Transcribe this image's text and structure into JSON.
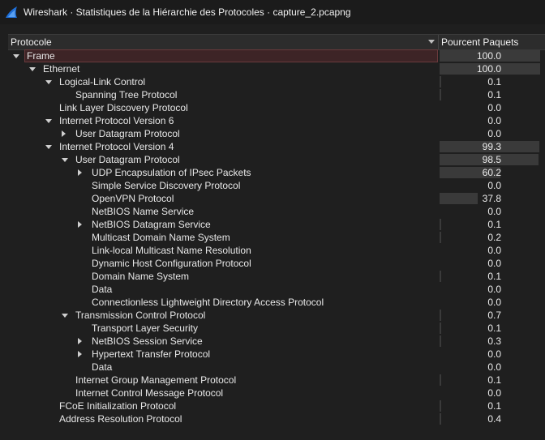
{
  "window": {
    "title": "Wireshark · Statistiques de la Hiérarchie des Protocoles · capture_2.pcapng",
    "app_icon": "wireshark-fin-icon",
    "accent_color": "#1e6fd9"
  },
  "table": {
    "columns": [
      "Protocole",
      "Pourcent Paquets"
    ],
    "rows": [
      {
        "name": "Frame",
        "percent": "100.0",
        "depth": 0,
        "expander": "open",
        "selected": true
      },
      {
        "name": "Ethernet",
        "percent": "100.0",
        "depth": 1,
        "expander": "open"
      },
      {
        "name": "Logical-Link Control",
        "percent": "0.1",
        "depth": 2,
        "expander": "open"
      },
      {
        "name": "Spanning Tree Protocol",
        "percent": "0.1",
        "depth": 3,
        "expander": "none"
      },
      {
        "name": "Link Layer Discovery Protocol",
        "percent": "0.0",
        "depth": 2,
        "expander": "none"
      },
      {
        "name": "Internet Protocol Version 6",
        "percent": "0.0",
        "depth": 2,
        "expander": "open"
      },
      {
        "name": "User Datagram Protocol",
        "percent": "0.0",
        "depth": 3,
        "expander": "closed"
      },
      {
        "name": "Internet Protocol Version 4",
        "percent": "99.3",
        "depth": 2,
        "expander": "open"
      },
      {
        "name": "User Datagram Protocol",
        "percent": "98.5",
        "depth": 3,
        "expander": "open"
      },
      {
        "name": "UDP Encapsulation of IPsec Packets",
        "percent": "60.2",
        "depth": 4,
        "expander": "closed"
      },
      {
        "name": "Simple Service Discovery Protocol",
        "percent": "0.0",
        "depth": 4,
        "expander": "none"
      },
      {
        "name": "OpenVPN Protocol",
        "percent": "37.8",
        "depth": 4,
        "expander": "none"
      },
      {
        "name": "NetBIOS Name Service",
        "percent": "0.0",
        "depth": 4,
        "expander": "none"
      },
      {
        "name": "NetBIOS Datagram Service",
        "percent": "0.1",
        "depth": 4,
        "expander": "closed"
      },
      {
        "name": "Multicast Domain Name System",
        "percent": "0.2",
        "depth": 4,
        "expander": "none"
      },
      {
        "name": "Link-local Multicast Name Resolution",
        "percent": "0.0",
        "depth": 4,
        "expander": "none"
      },
      {
        "name": "Dynamic Host Configuration Protocol",
        "percent": "0.0",
        "depth": 4,
        "expander": "none"
      },
      {
        "name": "Domain Name System",
        "percent": "0.1",
        "depth": 4,
        "expander": "none"
      },
      {
        "name": "Data",
        "percent": "0.0",
        "depth": 4,
        "expander": "none"
      },
      {
        "name": "Connectionless Lightweight Directory Access Protocol",
        "percent": "0.0",
        "depth": 4,
        "expander": "none"
      },
      {
        "name": "Transmission Control Protocol",
        "percent": "0.7",
        "depth": 3,
        "expander": "open"
      },
      {
        "name": "Transport Layer Security",
        "percent": "0.1",
        "depth": 4,
        "expander": "none"
      },
      {
        "name": "NetBIOS Session Service",
        "percent": "0.3",
        "depth": 4,
        "expander": "closed"
      },
      {
        "name": "Hypertext Transfer Protocol",
        "percent": "0.0",
        "depth": 4,
        "expander": "closed"
      },
      {
        "name": "Data",
        "percent": "0.0",
        "depth": 4,
        "expander": "none"
      },
      {
        "name": "Internet Group Management Protocol",
        "percent": "0.1",
        "depth": 3,
        "expander": "none"
      },
      {
        "name": "Internet Control Message Protocol",
        "percent": "0.0",
        "depth": 3,
        "expander": "none"
      },
      {
        "name": "FCoE Initialization Protocol",
        "percent": "0.1",
        "depth": 2,
        "expander": "none"
      },
      {
        "name": "Address Resolution Protocol",
        "percent": "0.4",
        "depth": 2,
        "expander": "none"
      }
    ]
  }
}
